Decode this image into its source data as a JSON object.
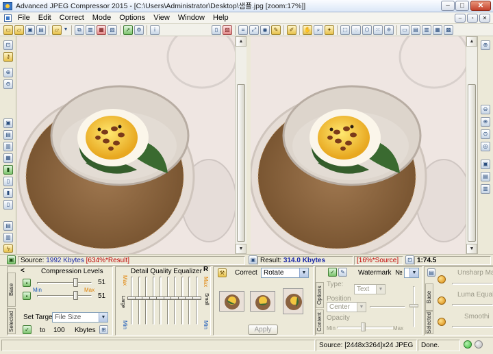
{
  "window": {
    "title": "Advanced JPEG Compressor 2015 - [C:\\Users\\Administrator\\Desktop\\샘플.jpg  [zoom:17%]]",
    "minimize_label": "–",
    "maximize_label": "□",
    "close_label": "✕",
    "restore_label": "▫"
  },
  "menu": {
    "items": [
      "File",
      "Edit",
      "Correct",
      "Mode",
      "Options",
      "View",
      "Window",
      "Help"
    ]
  },
  "info_bar": {
    "source_label": "Source:",
    "source_size": "1992 Kbytes",
    "source_ratio": "[634%*Result]",
    "result_label": "Result:",
    "result_size": "314.0 Kbytes",
    "result_ratio": "[16%*Source]",
    "ratio": "1:74.5"
  },
  "compression": {
    "title": "Compression Levels",
    "back_arrow": "<",
    "min_label": "Min",
    "max_label": "Max",
    "value1": "51",
    "value2": "51",
    "level1": 0.72,
    "level2": 0.72,
    "base_tab": "Base",
    "selected_tab": "Selected",
    "set_target_label": "Set Target",
    "target_mode": "File Size",
    "to_label": "to",
    "target_value": "100",
    "target_unit": "Kbytes"
  },
  "equalizer": {
    "title": "Detail Quality Equalizer",
    "r_label": "R",
    "max_label": "Max",
    "min_label": "Min",
    "large_label": "Large",
    "small_label": "Small",
    "levels": [
      0.55,
      0.55,
      0.55,
      0.55,
      0.55,
      0.55,
      0.55,
      0.55,
      0.55,
      0.55
    ]
  },
  "correct": {
    "title": "Correct",
    "mode": "Rotate",
    "apply_label": "Apply"
  },
  "watermark": {
    "title": "Watermark",
    "number_label": "№",
    "options_tab": "Options",
    "content_tab": "Content",
    "type_label": "Type:",
    "type_value": "Text",
    "position_label": "Position",
    "position_value": "Center",
    "opacity_label": "Opacity",
    "min_label": "Min",
    "max_label": "Max"
  },
  "adjust": {
    "base_tab": "Base",
    "selected_tab": "Selected",
    "unsharp_label": "Unsharp Ma",
    "luma_label": "Luma Equal",
    "smooth_label": "Smoothi"
  },
  "status": {
    "source_info": "Source: [2448x3264]x24 JPEG",
    "state": "Done."
  },
  "icons": {
    "app": "app-icon",
    "wrench": "wrench-icon",
    "watermark": "watermark-icon"
  },
  "colors": {
    "source_size": "#1a28a8",
    "result_size": "#1a28a8",
    "ratio_highlight": "#c00000",
    "max_label": "#e08000",
    "min_label": "#1a5ab8",
    "led_green": "#3bbf3b",
    "led_gray": "#b8b8b8"
  }
}
